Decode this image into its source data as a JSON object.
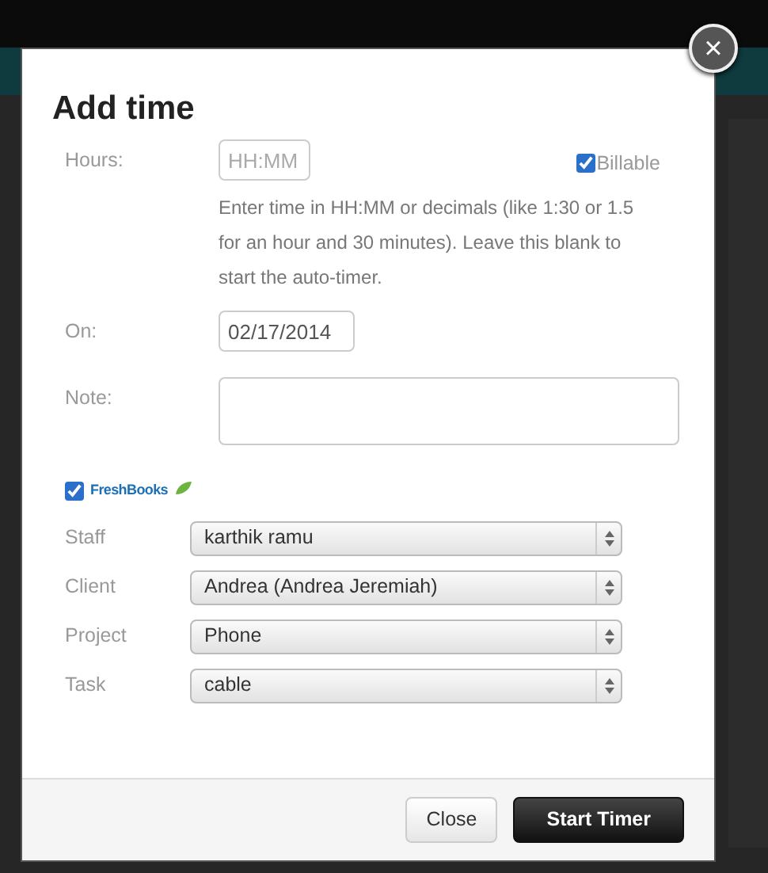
{
  "dialog": {
    "title": "Add time",
    "close_glyph": "×"
  },
  "hours": {
    "label": "Hours:",
    "placeholder": "HH:MM",
    "help": "Enter time in HH:MM or decimals (like 1:30 or 1.5 for an hour and 30 minutes). Leave this blank to start the auto-timer."
  },
  "billable": {
    "label": "Billable",
    "checked": true
  },
  "date": {
    "label": "On:",
    "value": "02/17/2014"
  },
  "note": {
    "label": "Note:"
  },
  "freshbooks": {
    "logo_text": "FreshBooks",
    "checked": true
  },
  "selects": [
    {
      "label": "Staff",
      "value": "karthik ramu"
    },
    {
      "label": "Client",
      "value": "Andrea (Andrea Jeremiah)"
    },
    {
      "label": "Project",
      "value": "Phone"
    },
    {
      "label": "Task",
      "value": "cable"
    }
  ],
  "buttons": [
    {
      "label": "Close",
      "kind": "secondary"
    },
    {
      "label": "Start Timer",
      "kind": "primary"
    }
  ]
}
